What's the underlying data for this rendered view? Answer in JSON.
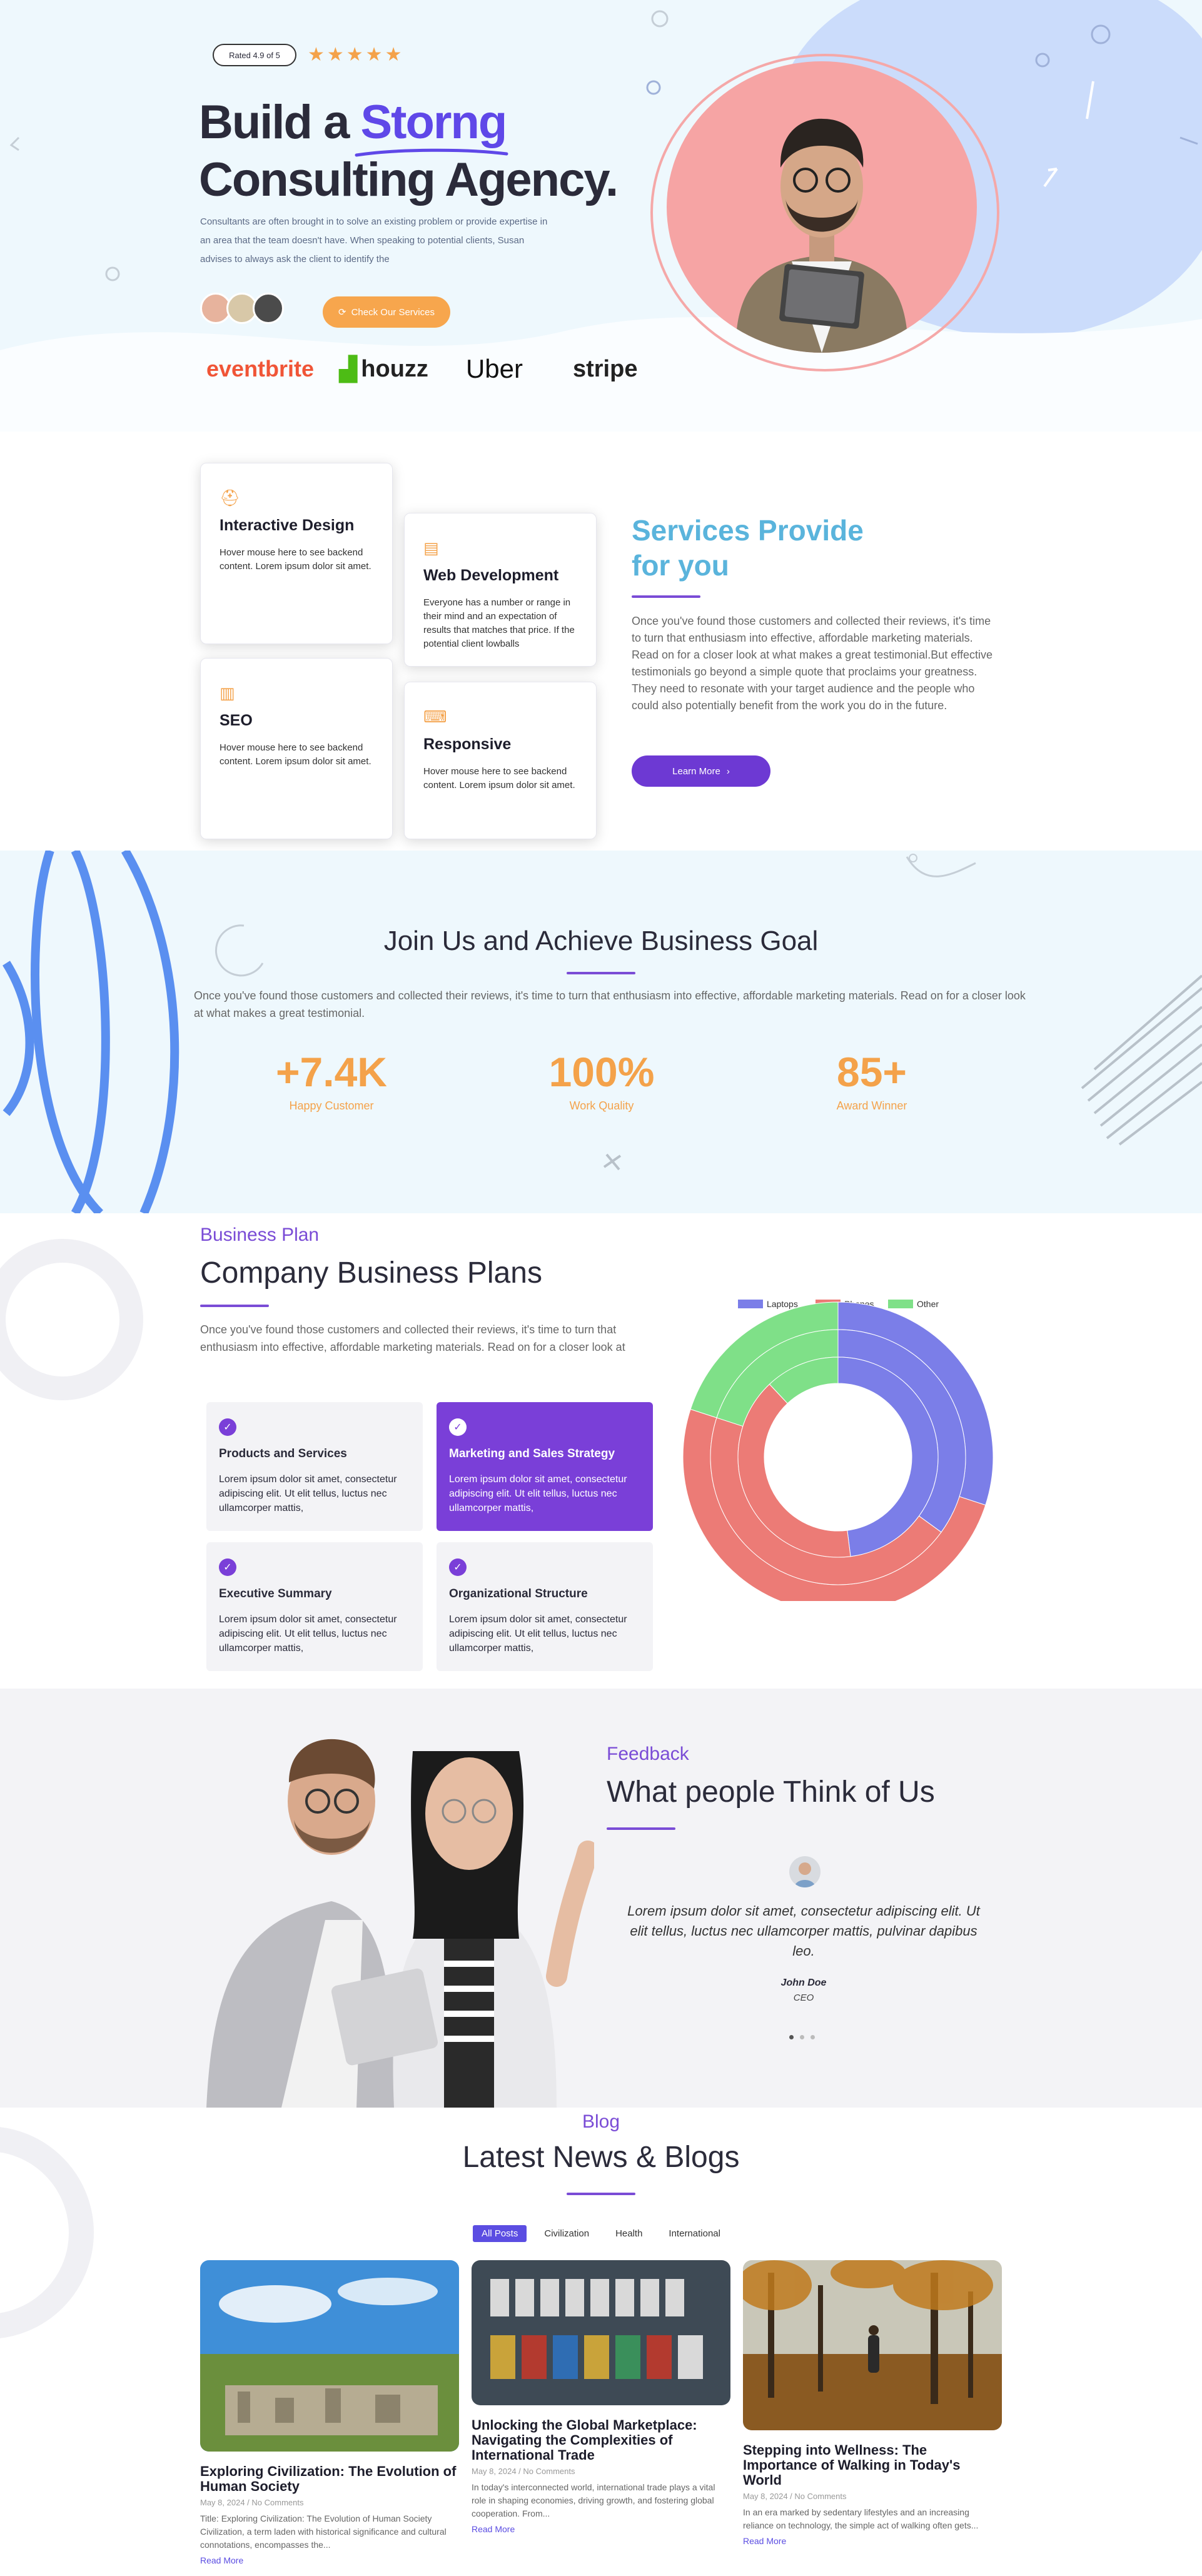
{
  "hero": {
    "rating_badge": "Rated 4.9 of 5",
    "stars": "★★★★★",
    "title_line1_pre": "Build a ",
    "title_highlight": "Storng",
    "title_line2": "Consulting Agency.",
    "description": "Consultants are often brought in to solve an existing problem or provide expertise in an area that the team doesn't have. When speaking to potential clients, Susan advises to always ask the client to identify the",
    "cta_label": "Check Our Services",
    "brands": [
      "eventbrite",
      "houzz",
      "Uber",
      "stripe"
    ]
  },
  "services": {
    "cards": [
      {
        "icon": "designer-icon",
        "title": "Interactive Design",
        "text": "Hover mouse here to see backend content. Lorem ipsum dolor sit amet."
      },
      {
        "icon": "code-file-icon",
        "title": "Web Development",
        "text": "Everyone has a number or range in their mind and an expectation of results that matches that price. If the potential client lowballs"
      },
      {
        "icon": "bar-chart-icon",
        "title": "SEO",
        "text": "Hover mouse here to see backend content. Lorem ipsum dolor sit amet."
      },
      {
        "icon": "devices-icon",
        "title": "Responsive",
        "text": "Hover mouse here to see backend content. Lorem ipsum dolor sit amet."
      }
    ],
    "title_line1": "Services Provide",
    "title_line2": "for you",
    "description": "Once you've found those customers and collected their reviews, it's time to turn that enthusiasm into effective, affordable marketing materials. Read on for a closer look at what makes a great testimonial.But effective testimonials go beyond a simple quote that proclaims your greatness. They need to resonate with your target audience and the people who could also potentially benefit from the work you do in the future.",
    "button_label": "Learn More"
  },
  "join": {
    "title": "Join Us and Achieve Business Goal",
    "description": "Once you've found those customers and collected their reviews, it's time to turn that enthusiasm into effective, affordable marketing materials. Read on for a closer look at what makes a great testimonial.",
    "stats": [
      {
        "value": "+7.4K",
        "label": "Happy Customer"
      },
      {
        "value": "100%",
        "label": "Work Quality"
      },
      {
        "value": "85+",
        "label": "Award Winner"
      }
    ]
  },
  "plans": {
    "eyebrow": "Business Plan",
    "title": "Company Business Plans",
    "description": "Once you've found those customers and collected their reviews, it's time to turn that enthusiasm into effective, affordable marketing materials. Read on for a closer look at",
    "items": [
      {
        "title": "Products and Services",
        "text": "Lorem ipsum dolor sit amet, consectetur adipiscing elit. Ut elit tellus, luctus nec ullamcorper mattis,"
      },
      {
        "title": "Marketing and Sales Strategy",
        "text": "Lorem ipsum dolor sit amet, consectetur adipiscing elit. Ut elit tellus, luctus nec ullamcorper mattis,"
      },
      {
        "title": "Executive Summary",
        "text": "Lorem ipsum dolor sit amet, consectetur adipiscing elit. Ut elit tellus, luctus nec ullamcorper mattis,"
      },
      {
        "title": "Organizational Structure",
        "text": "Lorem ipsum dolor sit amet, consectetur adipiscing elit. Ut elit tellus, luctus nec ullamcorper mattis,"
      }
    ]
  },
  "chart_data": {
    "type": "pie",
    "title": "",
    "legend": [
      "Laptops",
      "Phones",
      "Other"
    ],
    "legend_position": "top",
    "colors": {
      "Laptops": "#7b7ee8",
      "Phones": "#ec7b76",
      "Other": "#7fe088"
    },
    "rings": [
      {
        "name": "outer",
        "values": {
          "Laptops": 30,
          "Phones": 50,
          "Other": 20
        }
      },
      {
        "name": "middle",
        "values": {
          "Laptops": 35,
          "Phones": 45,
          "Other": 20
        }
      },
      {
        "name": "inner",
        "values": {
          "Laptops": 48,
          "Phones": 40,
          "Other": 12
        }
      }
    ]
  },
  "feedback": {
    "eyebrow": "Feedback",
    "title": "What people Think of Us",
    "quote": "Lorem ipsum dolor sit amet, consectetur adipiscing elit. Ut elit tellus, luctus nec ullamcorper mattis, pulvinar dapibus leo.",
    "author": "John Doe",
    "role": "CEO",
    "dots": 3,
    "active_dot": 1
  },
  "blog": {
    "eyebrow": "Blog",
    "title": "Latest News & Blogs",
    "tabs": [
      "All Posts",
      "Civilization",
      "Health",
      "International"
    ],
    "posts": [
      {
        "title": "Exploring Civilization: The Evolution of Human Society",
        "date": "May 8, 2024",
        "comments": "No Comments",
        "excerpt": "Title: Exploring Civilization: The Evolution of Human Society Civilization, a term laden with historical significance and cultural connotations, encompasses the...",
        "read_more": "Read More"
      },
      {
        "title": "Unlocking the Global Marketplace: Navigating the Complexities of International Trade",
        "date": "May 8, 2024",
        "comments": "No Comments",
        "excerpt": "In today's interconnected world, international trade plays a vital role in shaping economies, driving growth, and fostering global cooperation. From...",
        "read_more": "Read More"
      },
      {
        "title": "Stepping into Wellness: The Importance of Walking in Today's World",
        "date": "May 8, 2024",
        "comments": "No Comments",
        "excerpt": "In an era marked by sedentary lifestyles and an increasing reliance on technology, the simple act of walking often gets...",
        "read_more": "Read More"
      }
    ]
  }
}
